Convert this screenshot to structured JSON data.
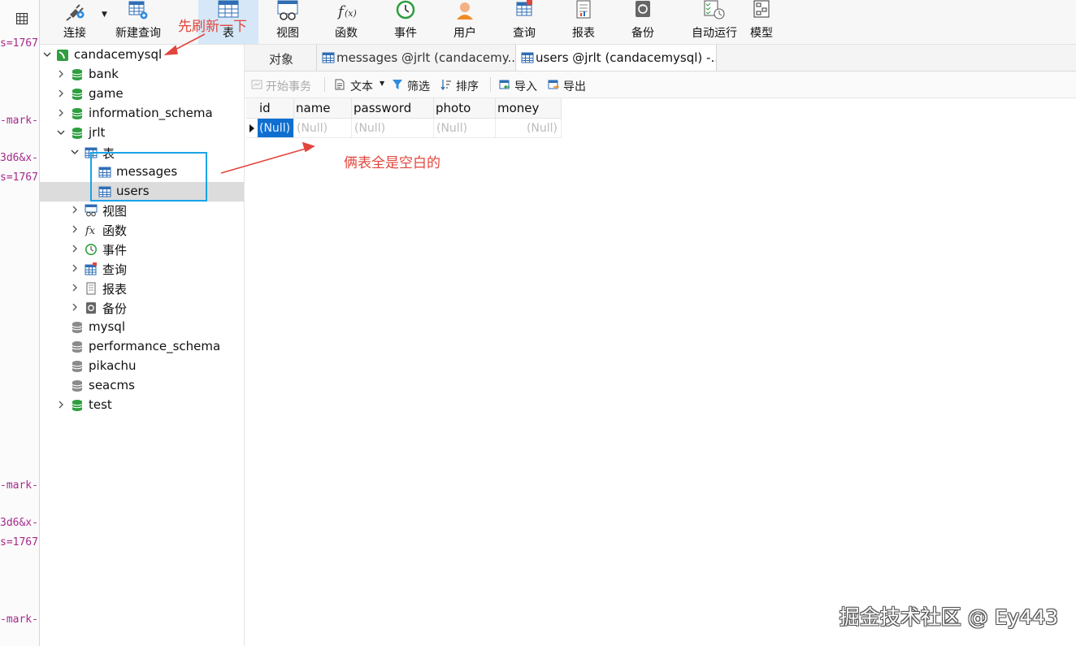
{
  "left_strip": {
    "fragments": [
      "s=1767",
      "-mark-",
      "3d6&x-",
      "s=1767",
      "-mark-",
      "3d6&x-",
      "s=1767",
      "-mark-"
    ]
  },
  "toolbar": {
    "items": [
      {
        "label": "连接",
        "icon": "plug-icon"
      },
      {
        "label": "新建查询",
        "icon": "new-query-icon"
      },
      {
        "label": "表",
        "icon": "table-icon"
      },
      {
        "label": "视图",
        "icon": "view-icon"
      },
      {
        "label": "函数",
        "icon": "function-icon"
      },
      {
        "label": "事件",
        "icon": "clock-icon"
      },
      {
        "label": "用户",
        "icon": "user-icon"
      },
      {
        "label": "查询",
        "icon": "query-icon"
      },
      {
        "label": "报表",
        "icon": "report-icon"
      },
      {
        "label": "备份",
        "icon": "backup-icon"
      },
      {
        "label": "自动运行",
        "icon": "schedule-icon"
      },
      {
        "label": "模型",
        "icon": "model-icon"
      }
    ]
  },
  "tree": {
    "connection": "candacemysql",
    "databases": [
      "bank",
      "game",
      "information_schema",
      "jrlt"
    ],
    "jrlt_children": {
      "tables_label": "表",
      "tables": [
        "messages",
        "users"
      ],
      "others": [
        "视图",
        "函数",
        "事件",
        "查询",
        "报表",
        "备份"
      ]
    },
    "more_databases": [
      "mysql",
      "performance_schema",
      "pikachu",
      "seacms",
      "test"
    ]
  },
  "tabs": [
    {
      "label": "对象"
    },
    {
      "label": "messages @jrlt (candacemy..."
    },
    {
      "label": "users @jrlt (candacemysql) -..."
    }
  ],
  "subtoolbar": {
    "begin_tx": "开始事务",
    "text": "文本",
    "filter": "筛选",
    "sort": "排序",
    "import": "导入",
    "export": "导出"
  },
  "grid": {
    "columns": [
      "id",
      "name",
      "password",
      "photo",
      "money"
    ],
    "rows": [
      [
        "(Null)",
        "(Null)",
        "(Null)",
        "(Null)",
        "(Null)"
      ]
    ]
  },
  "annotations": {
    "refresh_note": "先刷新一下",
    "empty_note": "俩表全是空白的"
  },
  "colors": {
    "accent": "#0f6fd0",
    "annotation": "#e2453c",
    "highlight_box": "#1aa3e8",
    "db_green": "#2e9e3e"
  },
  "watermark": "掘金技术社区 @ Ey443"
}
